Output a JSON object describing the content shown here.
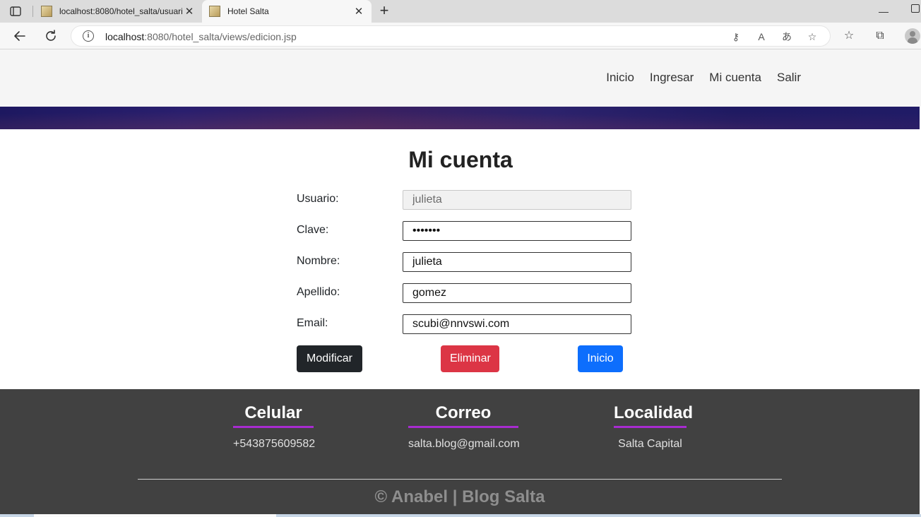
{
  "browser": {
    "tabs": [
      {
        "title": "localhost:8080/hotel_salta/usuari",
        "active": false
      },
      {
        "title": "Hotel Salta",
        "active": true
      }
    ],
    "url_host": "localhost",
    "url_path": ":8080/hotel_salta/views/edicion.jsp"
  },
  "nav": {
    "items": [
      "Inicio",
      "Ingresar",
      "Mi cuenta",
      "Salir"
    ]
  },
  "page": {
    "title": "Mi cuenta"
  },
  "form": {
    "usuario_label": "Usuario:",
    "usuario_value": "julieta",
    "clave_label": "Clave:",
    "clave_value": "1234567",
    "nombre_label": "Nombre:",
    "nombre_value": "julieta",
    "apellido_label": "Apellido:",
    "apellido_value": "gomez",
    "email_label": "Email:",
    "email_value": "scubi@nnvswi.com"
  },
  "buttons": {
    "modificar": "Modificar",
    "eliminar": "Eliminar",
    "inicio": "Inicio"
  },
  "colors": {
    "dark": "#212529",
    "danger": "#dc3545",
    "primary": "#0d6efd",
    "footer_bg": "#414141",
    "accent_underline": "#a72bd0"
  },
  "footer": {
    "celular_title": "Celular",
    "celular_value": "+543875609582",
    "correo_title": "Correo",
    "correo_value": "salta.blog@gmail.com",
    "localidad_title": "Localidad",
    "localidad_value": "Salta Capital",
    "copyright": "© Anabel | Blog Salta"
  }
}
